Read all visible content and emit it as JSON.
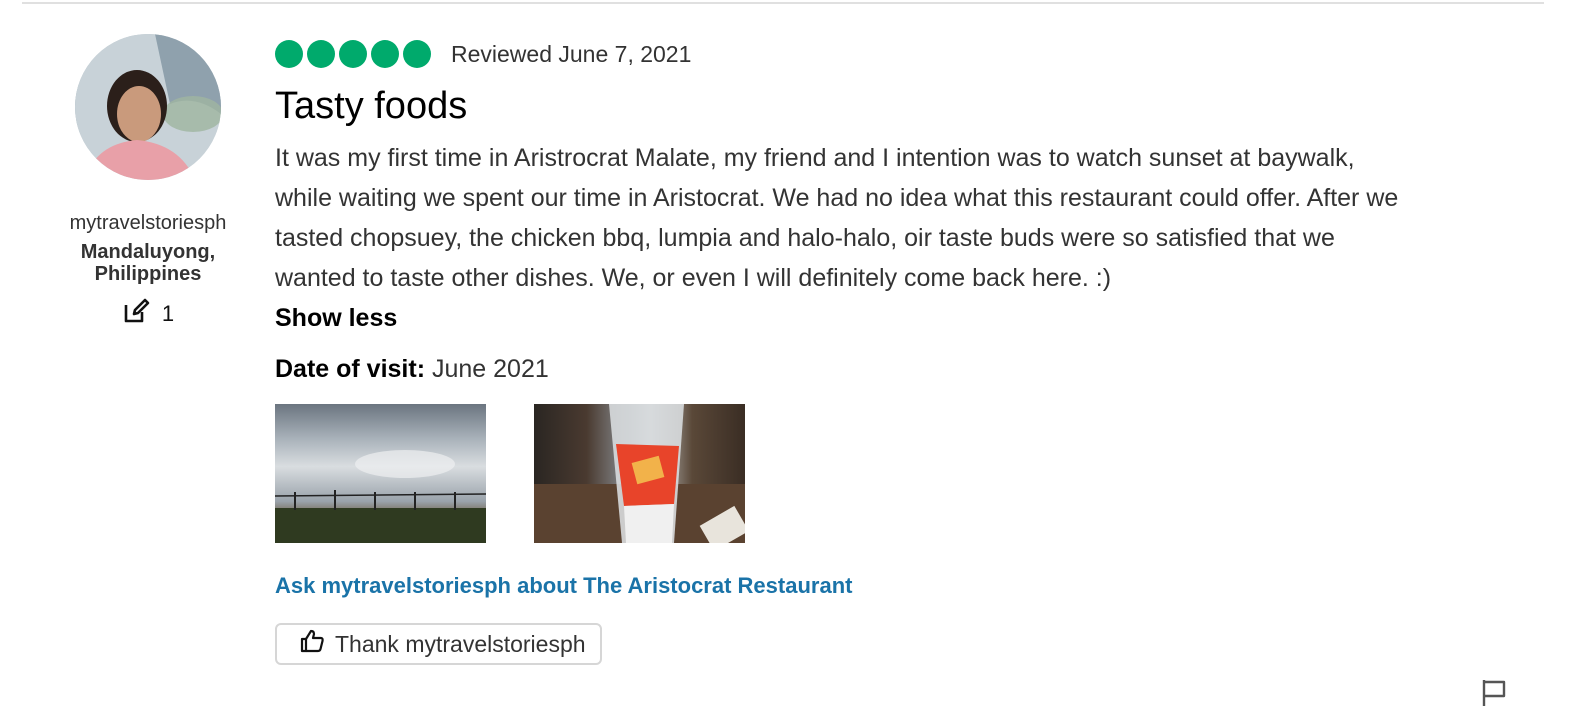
{
  "user": {
    "username": "mytravelstoriesph",
    "location": "Mandaluyong, Philippines",
    "contributions": "1",
    "contribution_icon": "edit-icon"
  },
  "review": {
    "rating": 5,
    "rating_color": "#00aa6c",
    "reviewed_date": "Reviewed June 7, 2021",
    "title": "Tasty foods",
    "body": "It was my first time in Aristrocrat Malate, my friend and I intention was to watch sunset at baywalk, while waiting we spent our time in Aristocrat. We had no idea what this restaurant could offer. After we tasted chopsuey, the chicken bbq, lumpia and halo-halo, oir taste buds were so satisfied that we wanted to taste other dishes. We, or even I will definitely come back here. :)",
    "show_less_label": "Show less",
    "visit_label": "Date of visit:",
    "visit_value": "June 2021"
  },
  "actions": {
    "ask_link": "Ask mytravelstoriesph about The Aristocrat Restaurant",
    "ask_link_color": "#1a73a8",
    "thank_label": "Thank mytravelstoriesph",
    "thank_icon": "thumbs-up-icon",
    "flag_icon": "flag-icon"
  }
}
